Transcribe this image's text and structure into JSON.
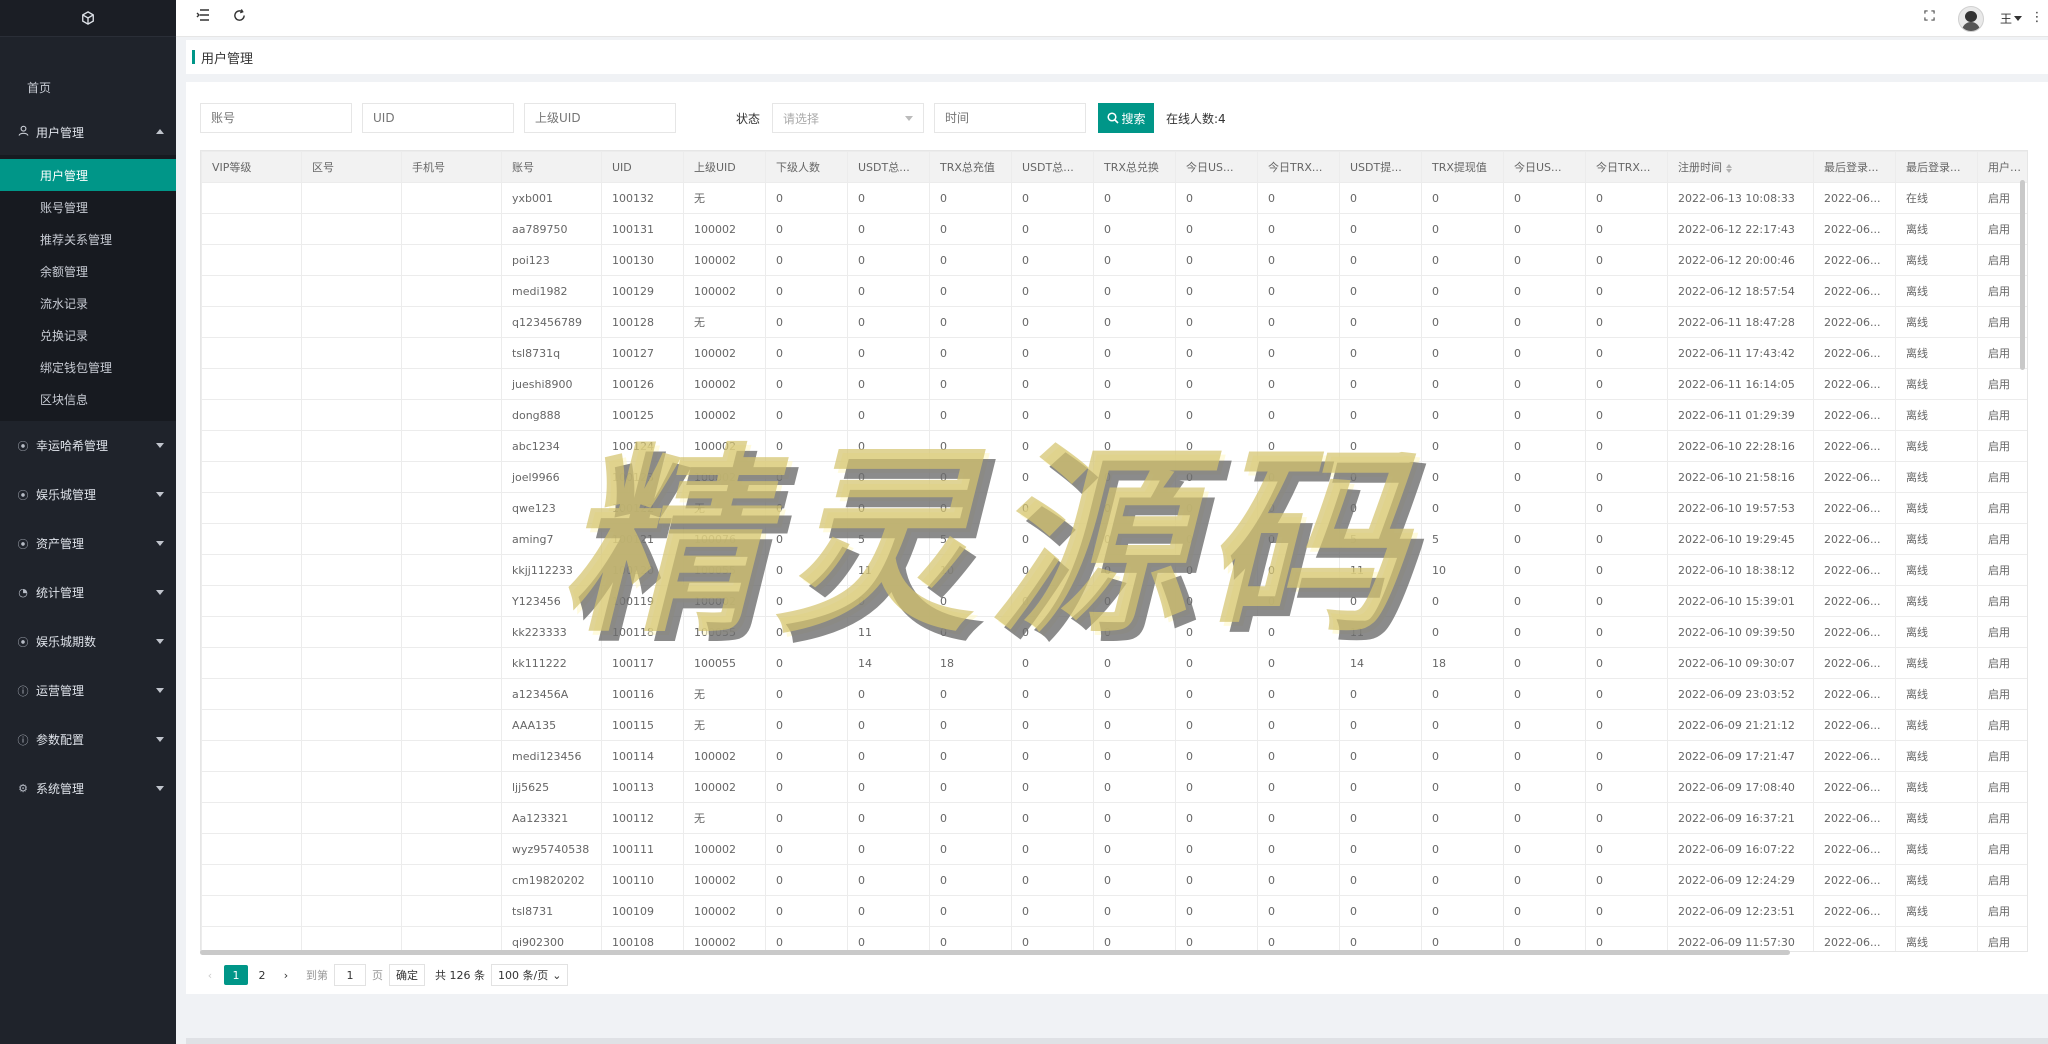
{
  "sidebar": {
    "home": "首页",
    "user_mgmt": {
      "label": "用户管理",
      "items": [
        "用户管理",
        "账号管理",
        "推荐关系管理",
        "余额管理",
        "流水记录",
        "兑换记录",
        "绑定钱包管理",
        "区块信息"
      ]
    },
    "groups": [
      "幸运哈希管理",
      "娱乐城管理",
      "资产管理",
      "统计管理",
      "娱乐城期数",
      "运营管理",
      "参数配置",
      "系统管理"
    ]
  },
  "topbar": {
    "username": "王"
  },
  "breadcrumb": {
    "title": "用户管理"
  },
  "filters": {
    "account_placeholder": "账号",
    "uid_placeholder": "UID",
    "parent_uid_placeholder": "上级UID",
    "status_label": "状态",
    "status_placeholder": "请选择",
    "time_placeholder": "时间",
    "search_label": "搜索",
    "online_count": "在线人数:4"
  },
  "table": {
    "columns": [
      "VIP等级",
      "区号",
      "手机号",
      "账号",
      "UID",
      "上级UID",
      "下级人数",
      "USDT总...",
      "TRX总充值",
      "USDT总...",
      "TRX总兑换",
      "今日US...",
      "今日TRX...",
      "USDT提...",
      "TRX提现值",
      "今日US...",
      "今日TRX...",
      "注册时间",
      "最后登录...",
      "最后登录...",
      "用户状态"
    ],
    "rows": [
      [
        "",
        "",
        "",
        "yxb001",
        "100132",
        "无",
        "0",
        "0",
        "0",
        "0",
        "0",
        "0",
        "0",
        "0",
        "0",
        "0",
        "0",
        "2022-06-13 10:08:33",
        "2022-06...",
        "在线",
        "启用"
      ],
      [
        "",
        "",
        "",
        "aa789750",
        "100131",
        "100002",
        "0",
        "0",
        "0",
        "0",
        "0",
        "0",
        "0",
        "0",
        "0",
        "0",
        "0",
        "2022-06-12 22:17:43",
        "2022-06...",
        "离线",
        "启用"
      ],
      [
        "",
        "",
        "",
        "poi123",
        "100130",
        "100002",
        "0",
        "0",
        "0",
        "0",
        "0",
        "0",
        "0",
        "0",
        "0",
        "0",
        "0",
        "2022-06-12 20:00:46",
        "2022-06...",
        "离线",
        "启用"
      ],
      [
        "",
        "",
        "",
        "medi1982",
        "100129",
        "100002",
        "0",
        "0",
        "0",
        "0",
        "0",
        "0",
        "0",
        "0",
        "0",
        "0",
        "0",
        "2022-06-12 18:57:54",
        "2022-06...",
        "离线",
        "启用"
      ],
      [
        "",
        "",
        "",
        "q123456789",
        "100128",
        "无",
        "0",
        "0",
        "0",
        "0",
        "0",
        "0",
        "0",
        "0",
        "0",
        "0",
        "0",
        "2022-06-11 18:47:28",
        "2022-06...",
        "离线",
        "启用"
      ],
      [
        "",
        "",
        "",
        "tsl8731q",
        "100127",
        "100002",
        "0",
        "0",
        "0",
        "0",
        "0",
        "0",
        "0",
        "0",
        "0",
        "0",
        "0",
        "2022-06-11 17:43:42",
        "2022-06...",
        "离线",
        "启用"
      ],
      [
        "",
        "",
        "",
        "jueshi8900",
        "100126",
        "100002",
        "0",
        "0",
        "0",
        "0",
        "0",
        "0",
        "0",
        "0",
        "0",
        "0",
        "0",
        "2022-06-11 16:14:05",
        "2022-06...",
        "离线",
        "启用"
      ],
      [
        "",
        "",
        "",
        "dong888",
        "100125",
        "100002",
        "0",
        "0",
        "0",
        "0",
        "0",
        "0",
        "0",
        "0",
        "0",
        "0",
        "0",
        "2022-06-11 01:29:39",
        "2022-06...",
        "离线",
        "启用"
      ],
      [
        "",
        "",
        "",
        "abc1234",
        "100124",
        "100002",
        "0",
        "0",
        "0",
        "0",
        "0",
        "0",
        "0",
        "0",
        "0",
        "0",
        "0",
        "2022-06-10 22:28:16",
        "2022-06...",
        "离线",
        "启用"
      ],
      [
        "",
        "",
        "",
        "joel9966",
        "100123",
        "100002",
        "0",
        "0",
        "0",
        "0",
        "0",
        "0",
        "0",
        "0",
        "0",
        "0",
        "0",
        "2022-06-10 21:58:16",
        "2022-06...",
        "离线",
        "启用"
      ],
      [
        "",
        "",
        "",
        "qwe123",
        "100122",
        "无",
        "0",
        "0",
        "0",
        "0",
        "0",
        "0",
        "0",
        "0",
        "0",
        "0",
        "0",
        "2022-06-10 19:57:53",
        "2022-06...",
        "离线",
        "启用"
      ],
      [
        "",
        "",
        "",
        "aming7",
        "100121",
        "100076",
        "0",
        "5",
        "5",
        "0",
        "0",
        "0",
        "0",
        "5",
        "5",
        "0",
        "0",
        "2022-06-10 19:29:45",
        "2022-06...",
        "离线",
        "启用"
      ],
      [
        "",
        "",
        "",
        "kkjj112233",
        "100120",
        "100055",
        "0",
        "11",
        "10",
        "0",
        "0",
        "0",
        "0",
        "11",
        "10",
        "0",
        "0",
        "2022-06-10 18:38:12",
        "2022-06...",
        "离线",
        "启用"
      ],
      [
        "",
        "",
        "",
        "Y123456",
        "100119",
        "100002",
        "0",
        "0",
        "0",
        "0",
        "0",
        "0",
        "0",
        "0",
        "0",
        "0",
        "0",
        "2022-06-10 15:39:01",
        "2022-06...",
        "离线",
        "启用"
      ],
      [
        "",
        "",
        "",
        "kk223333",
        "100118",
        "100055",
        "0",
        "11",
        "0",
        "0",
        "0",
        "0",
        "0",
        "11",
        "0",
        "0",
        "0",
        "2022-06-10 09:39:50",
        "2022-06...",
        "离线",
        "启用"
      ],
      [
        "",
        "",
        "",
        "kk111222",
        "100117",
        "100055",
        "0",
        "14",
        "18",
        "0",
        "0",
        "0",
        "0",
        "14",
        "18",
        "0",
        "0",
        "2022-06-10 09:30:07",
        "2022-06...",
        "离线",
        "启用"
      ],
      [
        "",
        "",
        "",
        "a123456A",
        "100116",
        "无",
        "0",
        "0",
        "0",
        "0",
        "0",
        "0",
        "0",
        "0",
        "0",
        "0",
        "0",
        "2022-06-09 23:03:52",
        "2022-06...",
        "离线",
        "启用"
      ],
      [
        "",
        "",
        "",
        "AAA135",
        "100115",
        "无",
        "0",
        "0",
        "0",
        "0",
        "0",
        "0",
        "0",
        "0",
        "0",
        "0",
        "0",
        "2022-06-09 21:21:12",
        "2022-06...",
        "离线",
        "启用"
      ],
      [
        "",
        "",
        "",
        "medi123456",
        "100114",
        "100002",
        "0",
        "0",
        "0",
        "0",
        "0",
        "0",
        "0",
        "0",
        "0",
        "0",
        "0",
        "2022-06-09 17:21:47",
        "2022-06...",
        "离线",
        "启用"
      ],
      [
        "",
        "",
        "",
        "ljj5625",
        "100113",
        "100002",
        "0",
        "0",
        "0",
        "0",
        "0",
        "0",
        "0",
        "0",
        "0",
        "0",
        "0",
        "2022-06-09 17:08:40",
        "2022-06...",
        "离线",
        "启用"
      ],
      [
        "",
        "",
        "",
        "Aa123321",
        "100112",
        "无",
        "0",
        "0",
        "0",
        "0",
        "0",
        "0",
        "0",
        "0",
        "0",
        "0",
        "0",
        "2022-06-09 16:37:21",
        "2022-06...",
        "离线",
        "启用"
      ],
      [
        "",
        "",
        "",
        "wyz95740538",
        "100111",
        "100002",
        "0",
        "0",
        "0",
        "0",
        "0",
        "0",
        "0",
        "0",
        "0",
        "0",
        "0",
        "2022-06-09 16:07:22",
        "2022-06...",
        "离线",
        "启用"
      ],
      [
        "",
        "",
        "",
        "cm19820202",
        "100110",
        "100002",
        "0",
        "0",
        "0",
        "0",
        "0",
        "0",
        "0",
        "0",
        "0",
        "0",
        "0",
        "2022-06-09 12:24:29",
        "2022-06...",
        "离线",
        "启用"
      ],
      [
        "",
        "",
        "",
        "tsl8731",
        "100109",
        "100002",
        "0",
        "0",
        "0",
        "0",
        "0",
        "0",
        "0",
        "0",
        "0",
        "0",
        "0",
        "2022-06-09 12:23:51",
        "2022-06...",
        "离线",
        "启用"
      ],
      [
        "",
        "",
        "",
        "qi902300",
        "100108",
        "100002",
        "0",
        "0",
        "0",
        "0",
        "0",
        "0",
        "0",
        "0",
        "0",
        "0",
        "0",
        "2022-06-09 11:57:30",
        "2022-06...",
        "离线",
        "启用"
      ]
    ]
  },
  "pager": {
    "pages": [
      "1",
      "2"
    ],
    "goto_prefix": "到第",
    "goto_value": "1",
    "goto_suffix": "页",
    "confirm": "确定",
    "total": "共 126 条",
    "page_size": "100 条/页"
  },
  "watermark": "精灵源码",
  "colors": {
    "accent": "#009688",
    "sidebar_bg": "#1f232b"
  }
}
